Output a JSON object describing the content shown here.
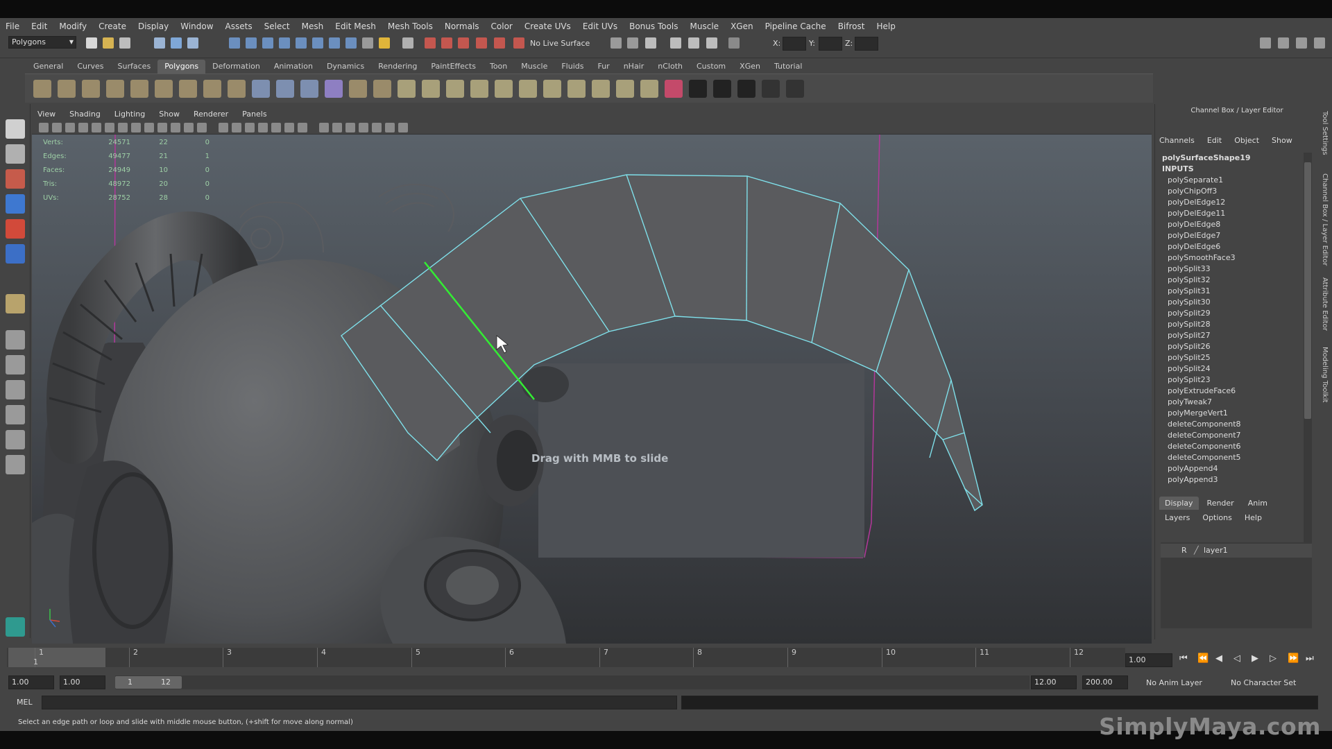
{
  "menubar": {
    "items": [
      "File",
      "Edit",
      "Modify",
      "Create",
      "Display",
      "Window",
      "Assets",
      "Select",
      "Mesh",
      "Edit Mesh",
      "Mesh Tools",
      "Normals",
      "Color",
      "Create UVs",
      "Edit UVs",
      "Bonus Tools",
      "Muscle",
      "XGen",
      "Pipeline Cache",
      "Bifrost",
      "Help"
    ]
  },
  "statusline": {
    "mode": "Polygons",
    "live_surface": "No Live Surface",
    "x_label": "X:",
    "y_label": "Y:",
    "z_label": "Z:"
  },
  "shelf": {
    "tabs": [
      "General",
      "Curves",
      "Surfaces",
      "Polygons",
      "Deformation",
      "Animation",
      "Dynamics",
      "Rendering",
      "PaintEffects",
      "Toon",
      "Muscle",
      "Fluids",
      "Fur",
      "nHair",
      "nCloth",
      "Custom",
      "XGen",
      "Tutorial"
    ],
    "active_tab": "Polygons"
  },
  "viewport": {
    "menu": [
      "View",
      "Shading",
      "Lighting",
      "Show",
      "Renderer",
      "Panels"
    ],
    "hud": [
      {
        "label": "Verts:",
        "a": "24571",
        "b": "22",
        "c": "0"
      },
      {
        "label": "Edges:",
        "a": "49477",
        "b": "21",
        "c": "1"
      },
      {
        "label": "Faces:",
        "a": "24949",
        "b": "10",
        "c": "0"
      },
      {
        "label": "Tris:",
        "a": "48972",
        "b": "20",
        "c": "0"
      },
      {
        "label": "UVs:",
        "a": "28752",
        "b": "28",
        "c": "0"
      }
    ],
    "hint": "Drag with MMB to slide"
  },
  "channel_box": {
    "title": "Channel Box / Layer Editor",
    "menu": [
      "Channels",
      "Edit",
      "Object",
      "Show"
    ],
    "shape": "polySurfaceShape19",
    "inputs_label": "INPUTS",
    "inputs": [
      "polySeparate1",
      "polyChipOff3",
      "polyDelEdge12",
      "polyDelEdge11",
      "polyDelEdge8",
      "polyDelEdge7",
      "polyDelEdge6",
      "polySmoothFace3",
      "polySplit33",
      "polySplit32",
      "polySplit31",
      "polySplit30",
      "polySplit29",
      "polySplit28",
      "polySplit27",
      "polySplit26",
      "polySplit25",
      "polySplit24",
      "polySplit23",
      "polyExtrudeFace6",
      "polyTweak7",
      "polyMergeVert1",
      "deleteComponent8",
      "deleteComponent7",
      "deleteComponent6",
      "deleteComponent5",
      "polyAppend4",
      "polyAppend3"
    ]
  },
  "layer_editor": {
    "tabs": [
      "Display",
      "Render",
      "Anim"
    ],
    "active_tab": "Display",
    "menu": [
      "Layers",
      "Options",
      "Help"
    ],
    "layer_flag": "R",
    "layer_name": "layer1"
  },
  "side_tabs": [
    "Tool Settings",
    "Channel Box / Layer Editor",
    "Attribute Editor",
    "Modeling Toolkit"
  ],
  "timeline": {
    "ticks": [
      "1",
      "2",
      "3",
      "4",
      "5",
      "6",
      "7",
      "8",
      "9",
      "10",
      "11",
      "12"
    ],
    "current_label": "1",
    "current_frame": "1.00"
  },
  "range": {
    "start": "1.00",
    "anim_start": "1.00",
    "slider_start": "1",
    "slider_end": "12",
    "end": "12.00",
    "anim_end": "200.00",
    "anim_layer": "No Anim Layer",
    "char_set": "No Character Set"
  },
  "mel": {
    "label": "MEL"
  },
  "help_line": "Select an edge path or loop and slide with middle mouse button, (+shift for move along normal)",
  "watermark": "SimplyMaya.com"
}
